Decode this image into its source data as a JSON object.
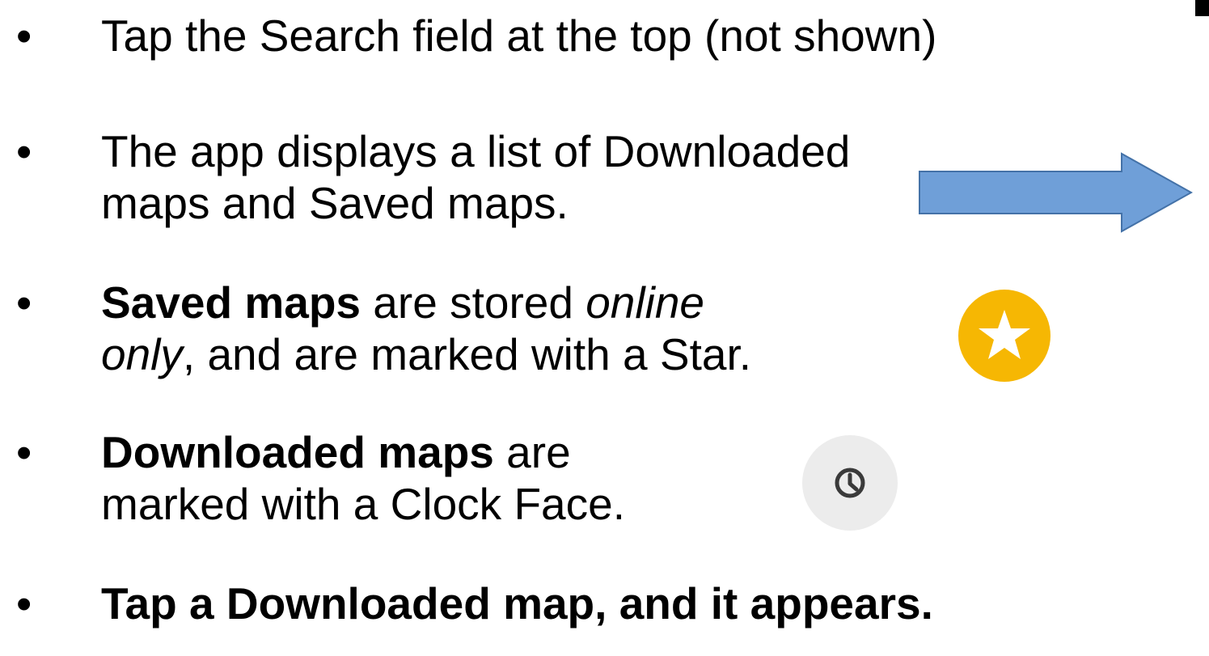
{
  "bullet_symbol": "•",
  "bullets": [
    {
      "text": "Tap the Search field at the top (not shown)"
    },
    {
      "line1": "The app displays a list of Downloaded",
      "line2": "maps and Saved maps."
    },
    {
      "bold": "Saved maps",
      "text_a": " are stored ",
      "italic_a": "online",
      "italic_b": "only",
      "text_b": ", and are marked with a Star."
    },
    {
      "bold": "Downloaded maps",
      "text_a": " are",
      "line2": "marked with a Clock Face."
    },
    {
      "bold": "Tap a Downloaded map, and it  appears."
    }
  ],
  "icons": {
    "arrow": "right-arrow-icon",
    "star": "star-icon",
    "clock": "clock-icon"
  },
  "colors": {
    "arrow_fill": "#6f9fd8",
    "arrow_stroke": "#4472a8",
    "star_badge": "#f6b703",
    "star": "#ffffff",
    "clock_badge": "#ececec",
    "clock_stroke": "#3a3a3a"
  }
}
